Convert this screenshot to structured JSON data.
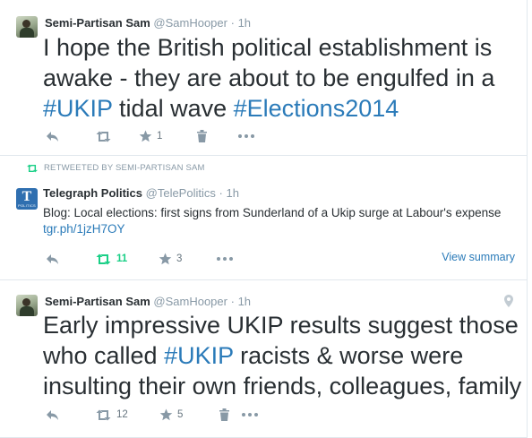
{
  "tweets": [
    {
      "name": "Semi-Partisan Sam",
      "handle": "@SamHooper",
      "separator": "·",
      "time": "1h",
      "text_parts": [
        "I hope the British political establishment is awake - they are about to be engulfed in a ",
        "#UKIP",
        " tidal wave ",
        "#Elections2014"
      ],
      "retweet_count": "",
      "favorite_count": "1"
    },
    {
      "retweeted_by": "RETWEETED BY SEMI-PARTISAN SAM",
      "avatar_text": "T",
      "avatar_subtext": "POLITICS",
      "name": "Telegraph Politics",
      "handle": "@TelePolitics",
      "separator": "·",
      "time": "1h",
      "text": "Blog: Local elections: first signs from Sunderland of a Ukip surge at Labour's expense ",
      "link": "tgr.ph/1jzH7OY",
      "retweet_count": "11",
      "favorite_count": "3",
      "view_summary": "View summary"
    },
    {
      "name": "Semi-Partisan Sam",
      "handle": "@SamHooper",
      "separator": "·",
      "time": "1h",
      "text_parts": [
        "Early impressive UKIP results suggest those who called ",
        "#UKIP",
        " racists & worse were insulting their own friends, colleagues, family"
      ],
      "retweet_count": "12",
      "favorite_count": "5"
    }
  ],
  "colors": {
    "link": "#2b7bb9",
    "retweet_active": "#19cf86",
    "muted": "#8899a6",
    "text": "#292f33",
    "border": "#e1e8ed"
  },
  "icons": [
    "reply-icon",
    "retweet-icon",
    "favorite-star-icon",
    "delete-trash-icon",
    "more-options-icon",
    "location-pin-icon"
  ]
}
